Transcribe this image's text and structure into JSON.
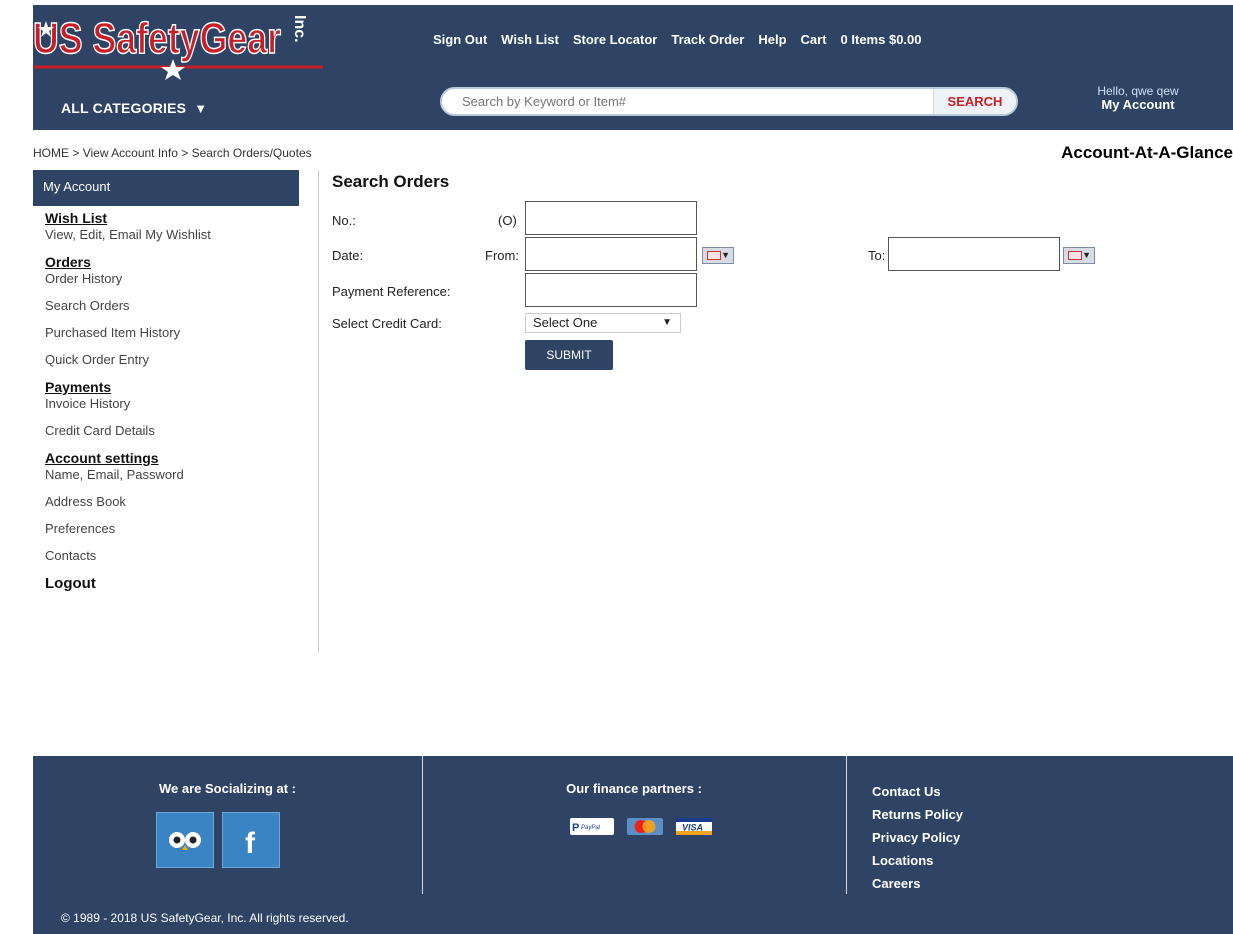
{
  "header": {
    "logo_text": "US SafetyGear",
    "logo_suffix": "Inc.",
    "nav": [
      "Sign Out",
      "Wish List",
      "Store Locator",
      "Track Order",
      "Help",
      "Cart"
    ],
    "cart_summary": "0 Items  $0.00",
    "all_categories": "ALL CATEGORIES",
    "search_placeholder": "Search by Keyword or Item#",
    "search_button": "SEARCH",
    "hello": "Hello, qwe qew",
    "my_account": "My Account"
  },
  "breadcrumb": {
    "home": "HOME",
    "sep": " > ",
    "view_account": "View Account Info",
    "current": "Search Orders/Quotes"
  },
  "page_title_right": "Account-At-A-Glance",
  "sidebar": {
    "header": "My Account",
    "sections": {
      "wish_list": "Wish List",
      "wish_list_item": "View, Edit, Email My Wishlist",
      "orders": "Orders",
      "order_history": "Order History",
      "search_orders": "Search Orders",
      "purchased_history": "Purchased Item History",
      "quick_order": "Quick Order Entry",
      "payments": "Payments",
      "invoice_history": "Invoice History",
      "credit_card_details": "Credit Card Details",
      "account_settings": "Account settings",
      "name_email": "Name, Email, Password",
      "address_book": "Address Book",
      "preferences": "Preferences",
      "contacts": "Contacts",
      "logout": "Logout"
    }
  },
  "form": {
    "title": "Search Orders",
    "no_label": "No.:",
    "no_prefix": "(O)",
    "no_value": "",
    "date_label": "Date:",
    "from_label": "From:",
    "from_value": "",
    "to_label": "To:",
    "to_value": "",
    "payment_ref_label": "Payment Reference:",
    "payment_ref_value": "",
    "credit_card_label": "Select Credit Card:",
    "credit_card_selected": "Select One",
    "submit": "SUBMIT"
  },
  "footer": {
    "social_title": "We are Socializing at :",
    "finance_title": "Our finance partners :",
    "links": [
      "Contact Us",
      "Returns Policy",
      "Privacy Policy",
      "Locations",
      "Careers"
    ],
    "copyright": "© 1989 - 2018 US SafetyGear, Inc. All rights reserved.",
    "payment_names": [
      "PayPal",
      "MasterCard",
      "VISA"
    ]
  },
  "colors": {
    "navy": "#2f4465",
    "logo_red": "#c81f26",
    "search_red": "#c81f26"
  }
}
